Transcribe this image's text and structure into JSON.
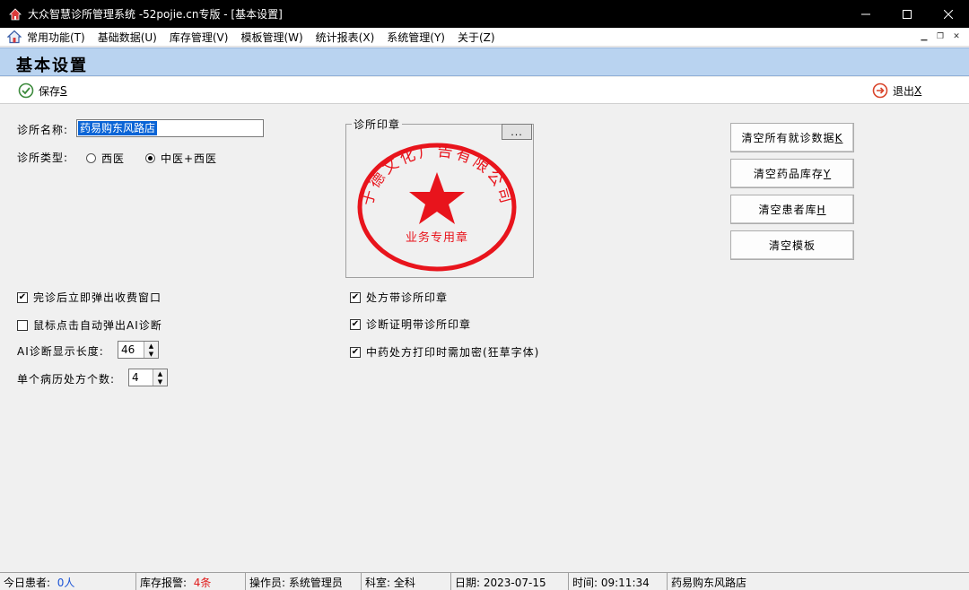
{
  "window": {
    "title": "大众智慧诊所管理系统 -52pojie.cn专版  - [基本设置]"
  },
  "menu": {
    "items": [
      "常用功能(T)",
      "基础数据(U)",
      "库存管理(V)",
      "模板管理(W)",
      "统计报表(X)",
      "系统管理(Y)",
      "关于(Z)"
    ]
  },
  "header": {
    "title": "基本设置"
  },
  "toolbar": {
    "save_label": "保存",
    "save_key": "S",
    "exit_label": "退出",
    "exit_key": "X"
  },
  "form": {
    "clinic_name_label": "诊所名称:",
    "clinic_name_value": "药易购东风路店",
    "clinic_type_label": "诊所类型:",
    "type_options": [
      "西医",
      "中医+西医"
    ],
    "type_selected": "中医+西医",
    "seal_group_label": "诊所印章",
    "browse_label": "...",
    "seal": {
      "top_text": "于德文化广告有限公司",
      "bottom_text": "业务专用章",
      "color": "#e8141c"
    },
    "checks_left": [
      {
        "label": "完诊后立即弹出收费窗口",
        "checked": true
      },
      {
        "label": "鼠标点击自动弹出AI诊断",
        "checked": false
      }
    ],
    "checks_right": [
      {
        "label": "处方带诊所印章",
        "checked": true
      },
      {
        "label": "诊断证明带诊所印章",
        "checked": true
      },
      {
        "label": "中药处方打印时需加密(狂草字体)",
        "checked": true
      }
    ],
    "ai_length_label": "AI诊断显示长度:",
    "ai_length_value": "46",
    "rx_count_label": "单个病历处方个数:",
    "rx_count_value": "4"
  },
  "actions": [
    {
      "label": "清空所有就诊数据",
      "key": "K"
    },
    {
      "label": "清空药品库存",
      "key": "Y"
    },
    {
      "label": "清空患者库",
      "key": "H"
    },
    {
      "label": "清空模板",
      "key": ""
    }
  ],
  "status": {
    "today_label": "今日患者:",
    "today_value": "0人",
    "stock_label": "库存报警:",
    "stock_value": "4条",
    "operator": "操作员: 系统管理员",
    "dept": "科室: 全科",
    "date": "日期: 2023-07-15",
    "time": "时间: 09:11:34",
    "store": "药易购东风路店"
  },
  "colors": {
    "header_bg": "#b9d3f0",
    "selection": "#0a64d6",
    "alert_red": "#e01a1a",
    "info_blue": "#1a53d6"
  }
}
